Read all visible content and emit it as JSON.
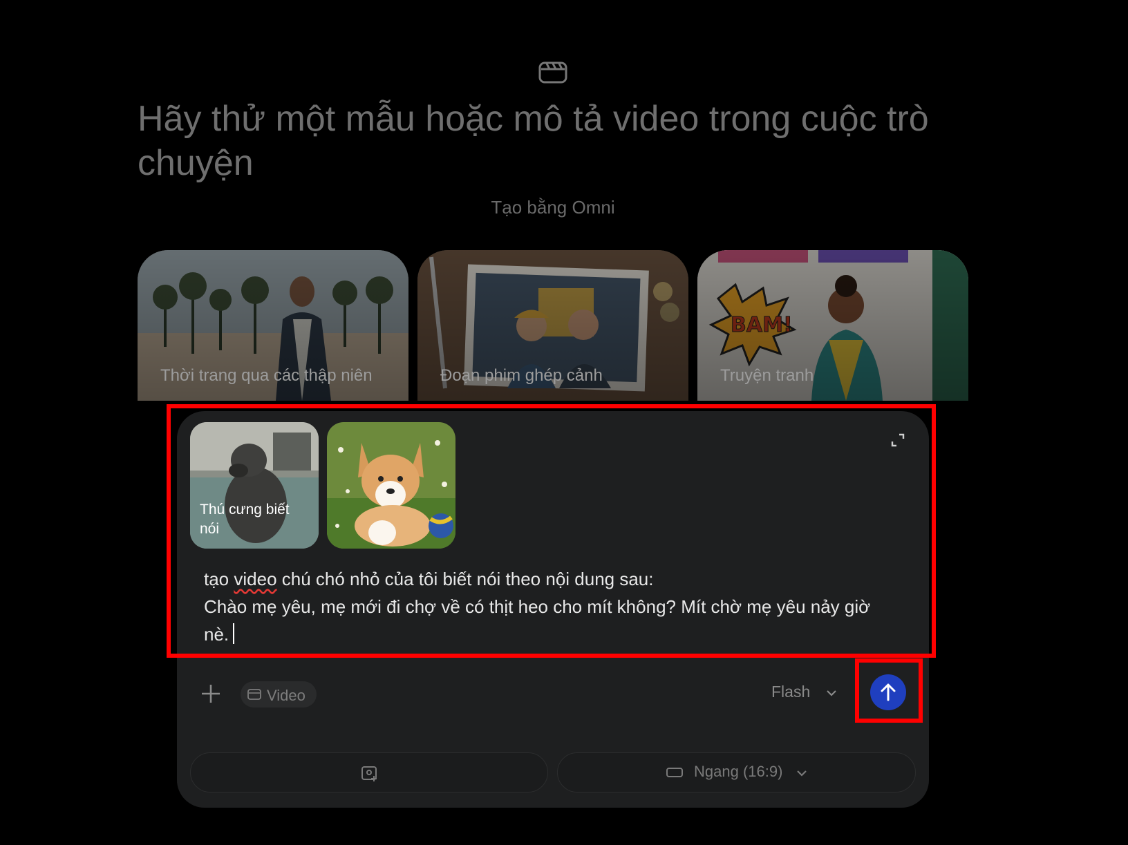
{
  "header": {
    "icon": "video-clapper-icon",
    "title": "Hãy thử một mẫu hoặc mô tả video trong cuộc trò chuyện",
    "subtitle": "Tạo bằng Omni"
  },
  "templates": [
    {
      "label": "Thời trang qua các thập niên"
    },
    {
      "label": "Đoạn phim ghép cảnh"
    },
    {
      "label": "Truyện tranh"
    }
  ],
  "composer": {
    "attachments": [
      {
        "label": "Thú cưng biết nói"
      },
      {
        "label": ""
      }
    ],
    "prompt_line1_a": "tạo ",
    "prompt_line1_word": "video",
    "prompt_line1_b": " chú chó nhỏ của tôi biết nói theo nội dung sau:",
    "prompt_line2": "Chào mẹ yêu, mẹ mới đi chợ về có thịt heo cho mít không? Mít chờ mẹ yêu nảy giờ nè.",
    "mode_chip": "Video",
    "model": "Flash",
    "aspect_ratio": "Ngang (16:9)"
  },
  "colors": {
    "highlight": "#ff0000",
    "send_button": "#1f3fbf",
    "background": "#000000"
  }
}
